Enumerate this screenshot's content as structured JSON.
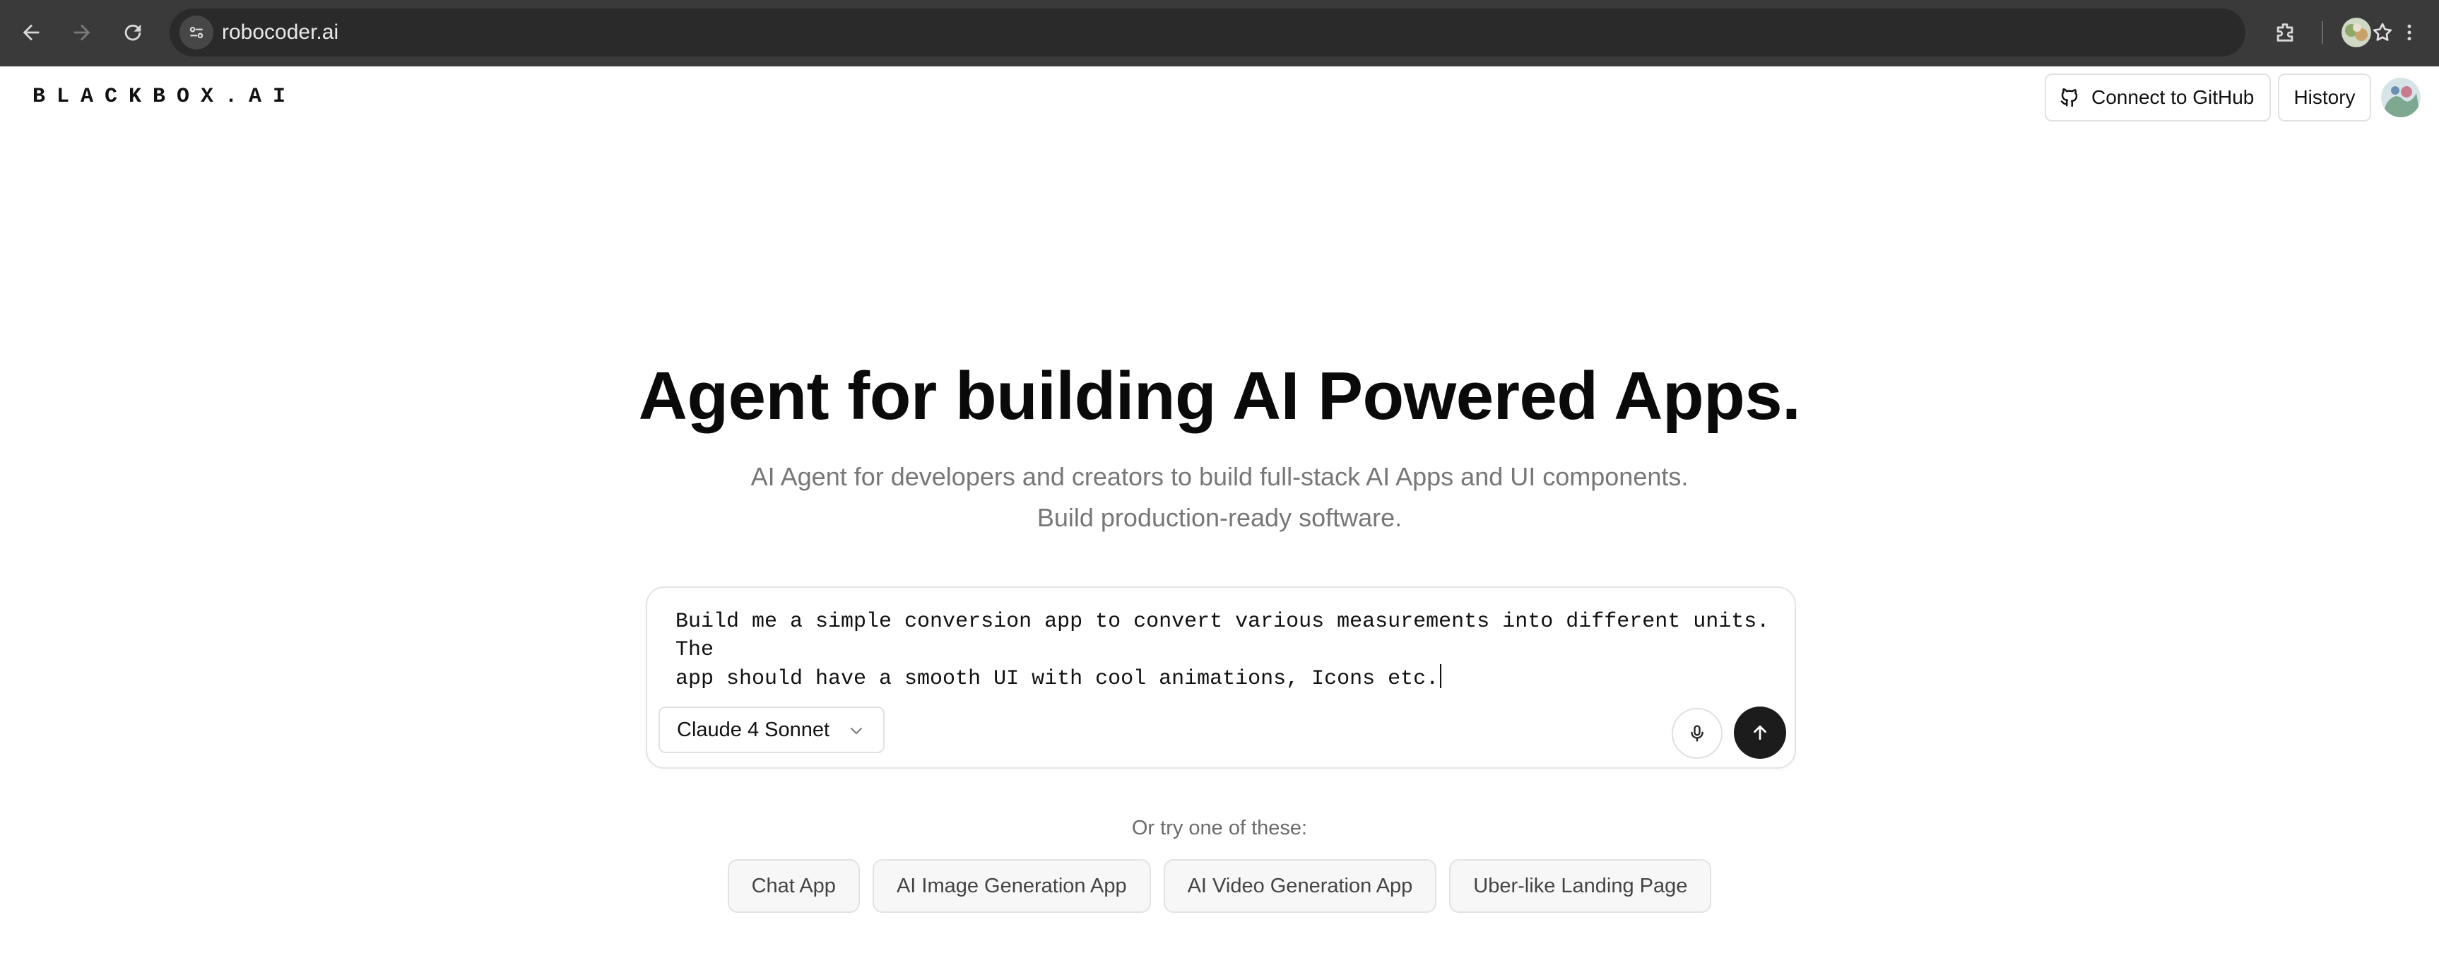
{
  "browser": {
    "url": "robocoder.ai",
    "icons": [
      "back-arrow-icon",
      "forward-arrow-icon",
      "reload-icon",
      "site-info-icon",
      "bookmark-star-icon",
      "extensions-icon",
      "profile-avatar",
      "more-vert-icon"
    ]
  },
  "header": {
    "logo": "BLACKBOX.AI",
    "github_button": "Connect to GitHub",
    "history_button": "History"
  },
  "hero": {
    "title": "Agent for building AI Powered Apps.",
    "subtitle_line1": "AI Agent for developers and creators to build full-stack AI Apps and UI components.",
    "subtitle_line2": "Build production-ready software."
  },
  "prompt": {
    "value": "Build me a simple conversion app to convert various measurements into different units. The\napp should have a smooth UI with cool animations, Icons etc.",
    "model": "Claude 4 Sonnet"
  },
  "suggestions": {
    "label": "Or try one of these:",
    "items": [
      "Chat App",
      "AI Image Generation App",
      "AI Video Generation App",
      "Uber-like Landing Page"
    ]
  },
  "colors": {
    "chrome_bg": "#3a3a3a",
    "omnibox_bg": "#2a2a2a",
    "send_button": "#1c1c1c",
    "chip_bg": "#f7f7f7"
  }
}
